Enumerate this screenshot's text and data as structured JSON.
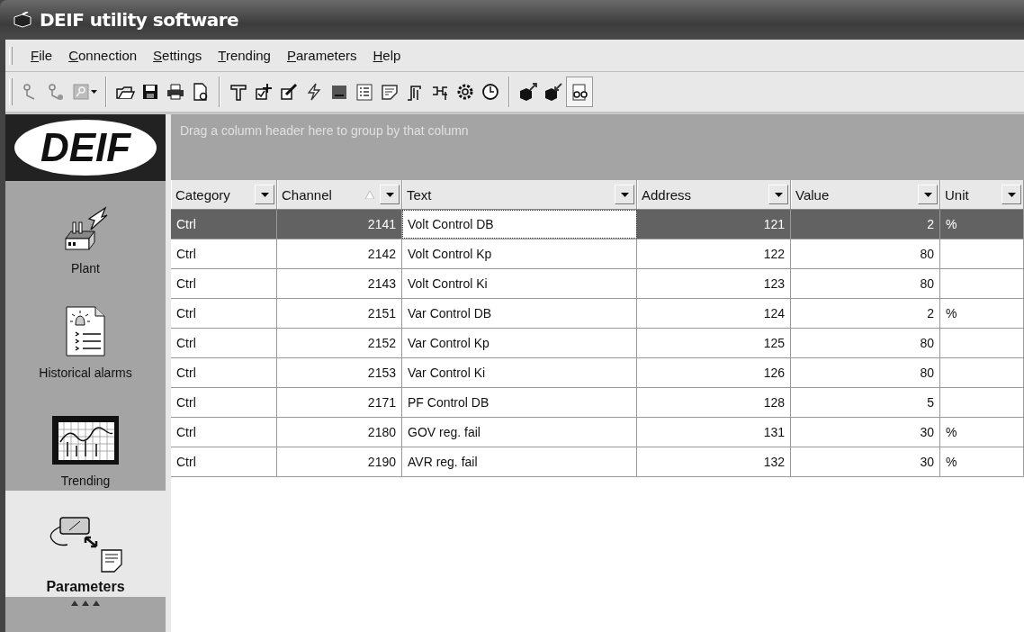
{
  "window": {
    "title": "DEIF utility software"
  },
  "menu": [
    {
      "label": "File"
    },
    {
      "label": "Connection"
    },
    {
      "label": "Settings"
    },
    {
      "label": "Trending"
    },
    {
      "label": "Parameters"
    },
    {
      "label": "Help"
    }
  ],
  "sidebar": {
    "logo": "DEIF",
    "items": [
      {
        "label": "Plant",
        "kind": "plant",
        "selected": false
      },
      {
        "label": "Historical alarms",
        "kind": "alarms",
        "selected": false
      },
      {
        "label": "Trending",
        "kind": "trend",
        "selected": false
      },
      {
        "label": "Parameters",
        "kind": "params",
        "selected": true
      }
    ]
  },
  "table": {
    "group_hint": "Drag a column header here to group by that column",
    "columns": [
      {
        "label": "Category",
        "kind": "text",
        "sorted": false,
        "focused": false
      },
      {
        "label": "Channel",
        "kind": "number",
        "sorted": true,
        "focused": false
      },
      {
        "label": "Text",
        "kind": "text",
        "sorted": false,
        "focused": true
      },
      {
        "label": "Address",
        "kind": "number",
        "sorted": false,
        "focused": false
      },
      {
        "label": "Value",
        "kind": "number",
        "sorted": false,
        "focused": false
      },
      {
        "label": "Unit",
        "kind": "text",
        "sorted": false,
        "focused": false
      }
    ],
    "rows": [
      {
        "selected": true,
        "cells": [
          "Ctrl",
          "2141",
          "Volt Control DB",
          "121",
          "2",
          "%"
        ]
      },
      {
        "selected": false,
        "cells": [
          "Ctrl",
          "2142",
          "Volt Control Kp",
          "122",
          "80",
          ""
        ]
      },
      {
        "selected": false,
        "cells": [
          "Ctrl",
          "2143",
          "Volt Control Ki",
          "123",
          "80",
          ""
        ]
      },
      {
        "selected": false,
        "cells": [
          "Ctrl",
          "2151",
          "Var Control DB",
          "124",
          "2",
          "%"
        ]
      },
      {
        "selected": false,
        "cells": [
          "Ctrl",
          "2152",
          "Var Control Kp",
          "125",
          "80",
          ""
        ]
      },
      {
        "selected": false,
        "cells": [
          "Ctrl",
          "2153",
          "Var Control Ki",
          "126",
          "80",
          ""
        ]
      },
      {
        "selected": false,
        "cells": [
          "Ctrl",
          "2171",
          "PF Control DB",
          "128",
          "5",
          ""
        ]
      },
      {
        "selected": false,
        "cells": [
          "Ctrl",
          "2180",
          "GOV reg. fail",
          "131",
          "30",
          "%"
        ]
      },
      {
        "selected": false,
        "cells": [
          "Ctrl",
          "2190",
          "AVR reg. fail",
          "132",
          "30",
          "%"
        ]
      }
    ]
  }
}
